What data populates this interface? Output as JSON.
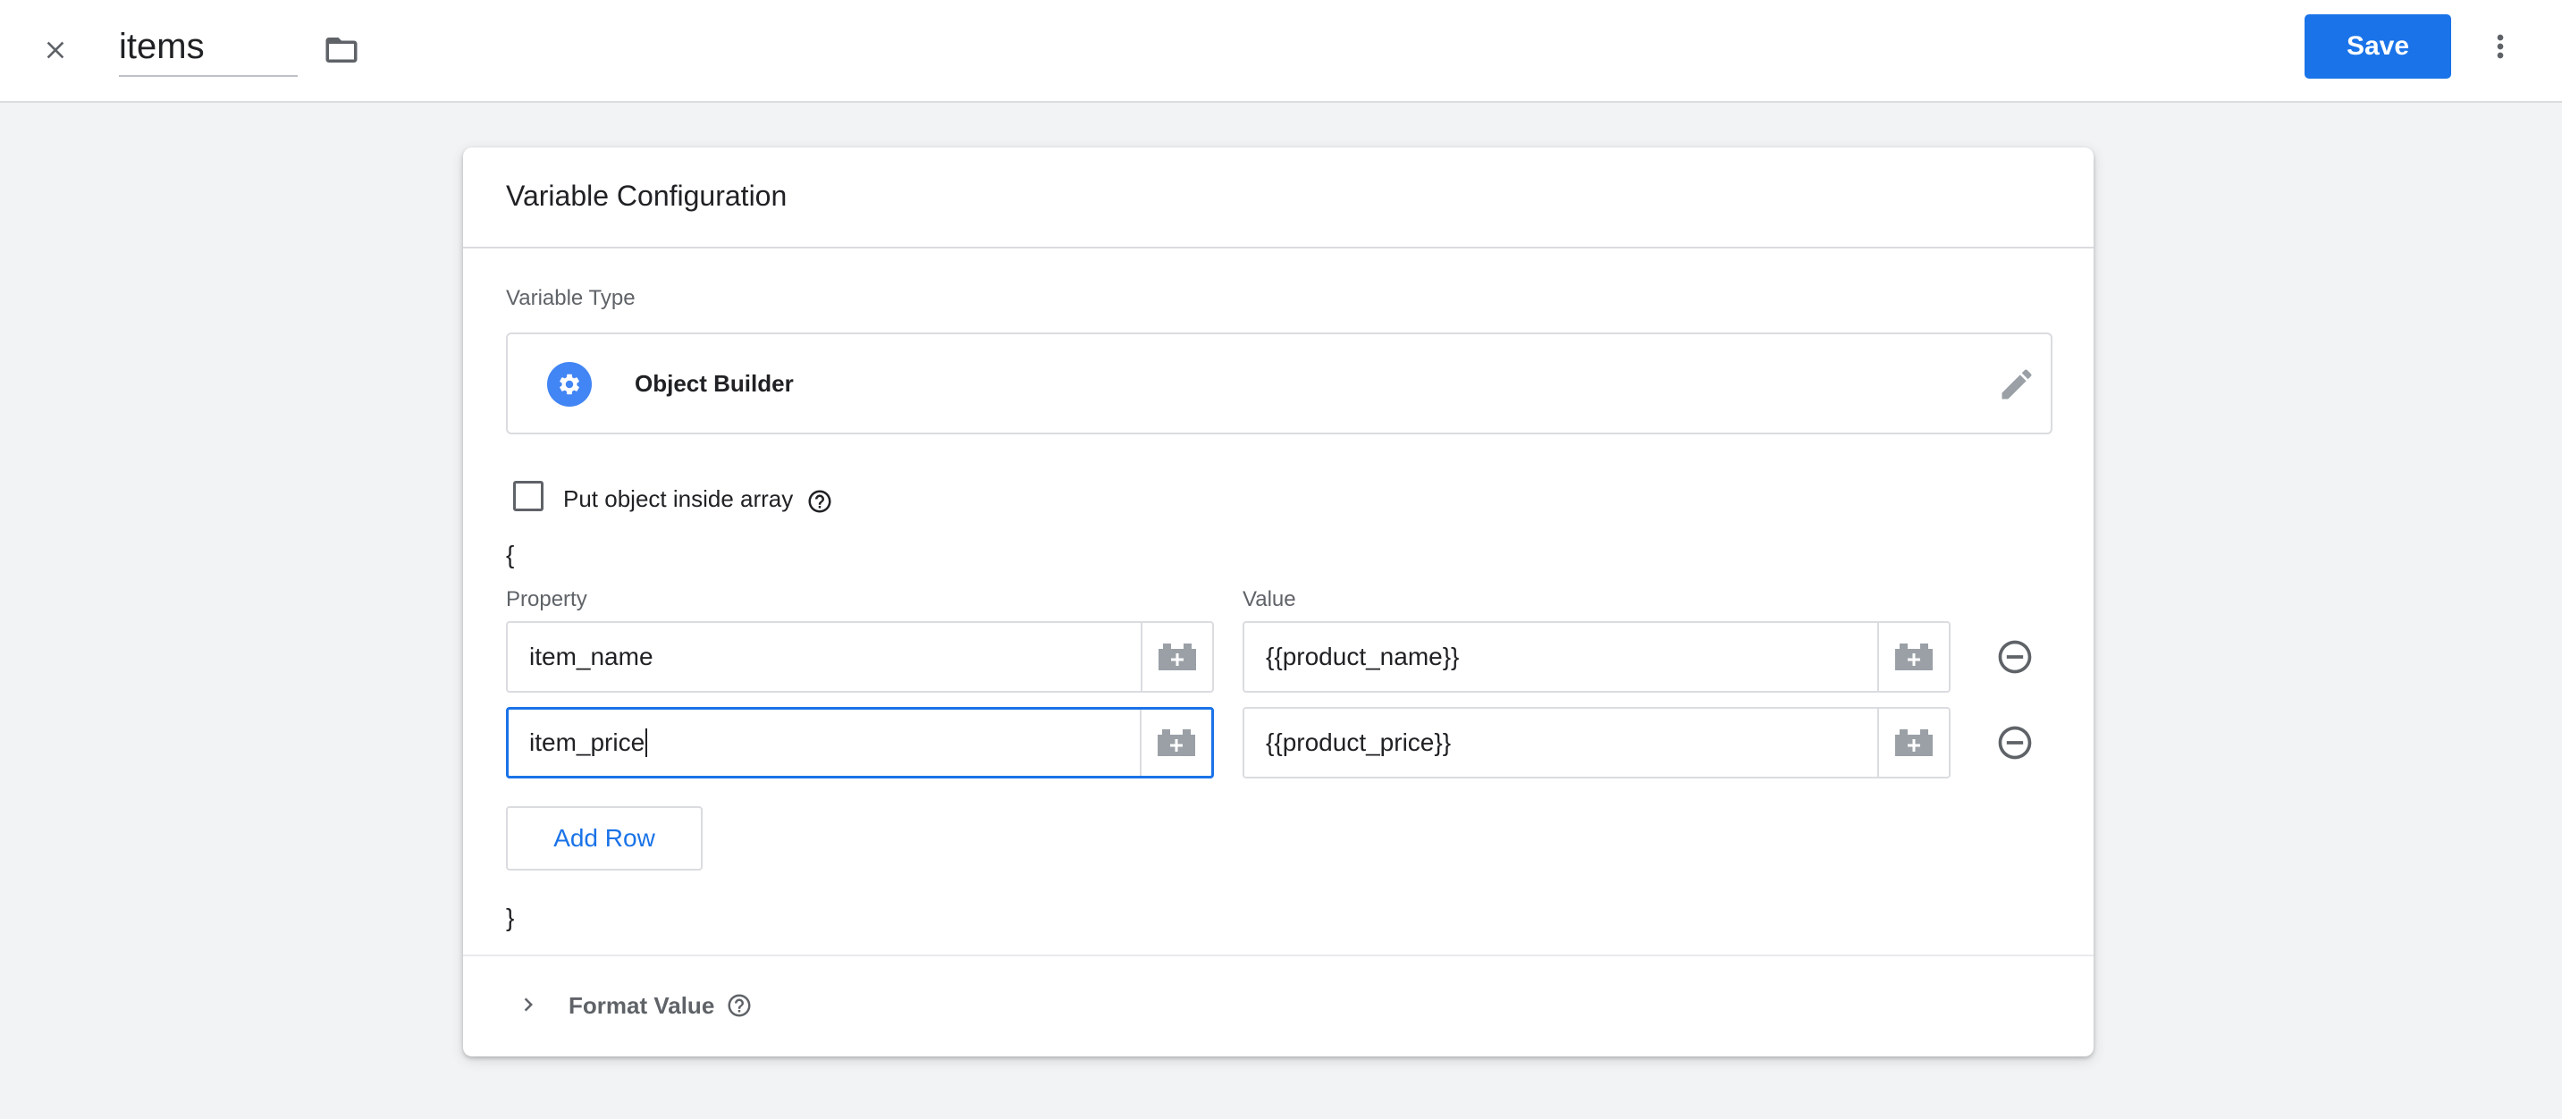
{
  "topbar": {
    "variable_name": "items",
    "save_label": "Save",
    "close_icon": "close-icon",
    "folder_icon": "folder-icon",
    "more_icon": "more-vert-icon"
  },
  "card": {
    "title": "Variable Configuration",
    "variable_type_label": "Variable Type",
    "variable_type_name": "Object Builder",
    "checkbox_label": "Put object inside array",
    "checkbox_checked": false,
    "open_brace": "{",
    "close_brace": "}",
    "property_label": "Property",
    "value_label": "Value",
    "rows": [
      {
        "property": "item_name",
        "value": "{{product_name}}"
      },
      {
        "property": "item_price",
        "value": "{{product_price}}"
      }
    ],
    "add_row_label": "Add Row",
    "format_value_label": "Format Value"
  },
  "colors": {
    "accent": "#1a73e8",
    "background": "#f1f3f4",
    "border": "#dadce0",
    "muted_text": "#5f6368"
  }
}
